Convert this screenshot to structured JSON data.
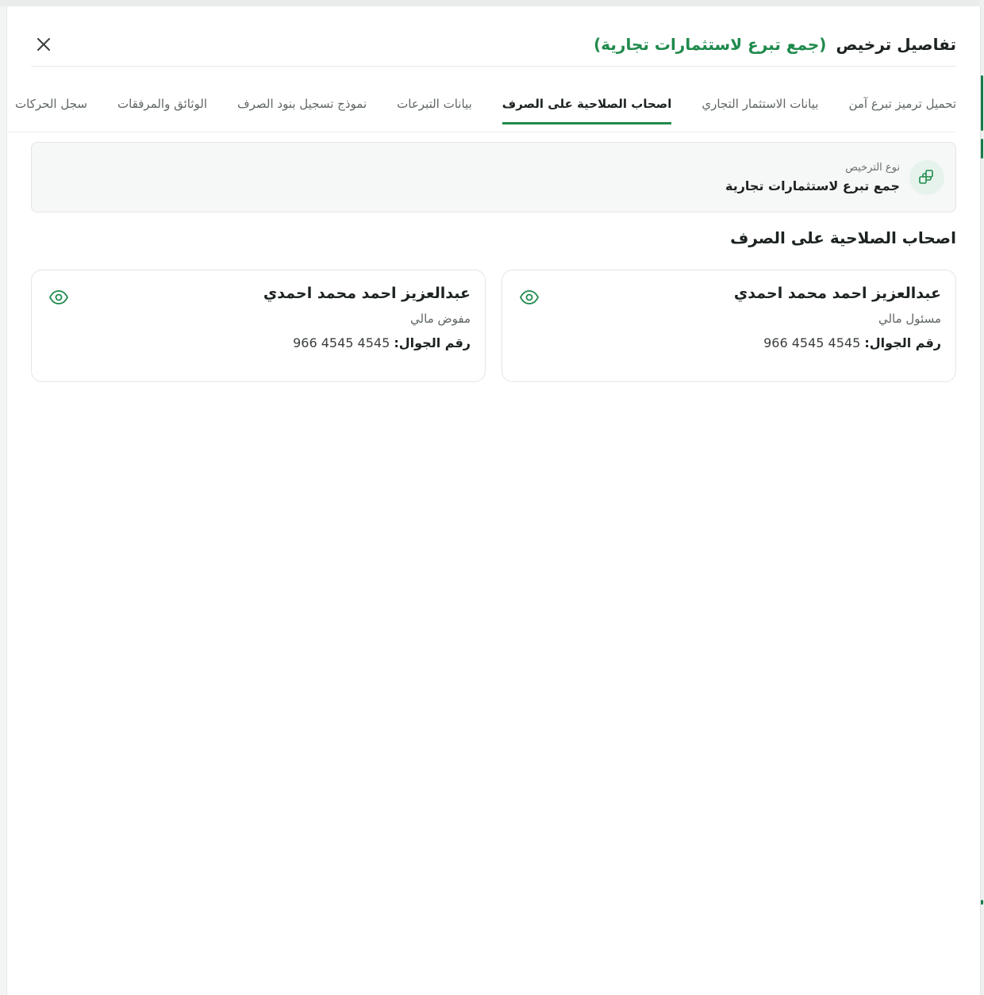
{
  "header": {
    "title": "تفاصيل ترخيص",
    "subtitle": "(جمع تبرع لاستثمارات تجارية)"
  },
  "tabs": [
    {
      "label": "تحميل ترميز تبرع آمن"
    },
    {
      "label": "بيانات الاستثمار التجاري"
    },
    {
      "label": "اصحاب الصلاحية على الصرف",
      "active": true
    },
    {
      "label": "بيانات التبرعات"
    },
    {
      "label": "نموذج تسجيل بنود الصرف"
    },
    {
      "label": "الوثائق والمرفقات"
    },
    {
      "label": "سجل الحركات"
    }
  ],
  "license": {
    "label": "نوع الترخيص",
    "value": "جمع تبرع لاستثمارات تجارية",
    "icon": "license-grid-icon"
  },
  "section_title": "اصحاب الصلاحية على الصرف",
  "cards": [
    {
      "name": "عبدالعزيز احمد محمد احمدي",
      "role": "مسئول مالي",
      "phone_label": "رقم الجوال:",
      "phone": "966 4545 4545"
    },
    {
      "name": "عبدالعزيز احمد محمد احمدي",
      "role": "مفوض مالي",
      "phone_label": "رقم الجوال:",
      "phone": "966 4545 4545"
    }
  ],
  "colors": {
    "accent": "#1f8a4c",
    "text": "#1d2320",
    "muted": "#5f6662"
  }
}
